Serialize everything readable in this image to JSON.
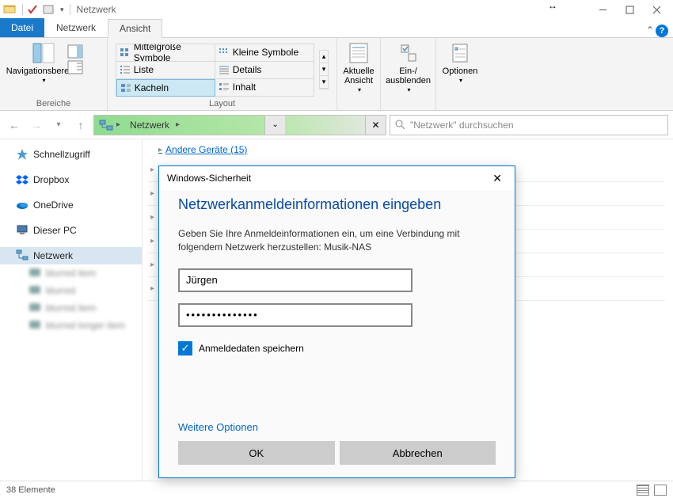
{
  "titlebar": {
    "title": "Netzwerk"
  },
  "tabs": {
    "file": "Datei",
    "network": "Netzwerk",
    "view": "Ansicht"
  },
  "ribbon": {
    "panes_btn": "Navigationsbereich",
    "panes_group": "Bereiche",
    "layout_group": "Layout",
    "layouts": {
      "medium": "Mittelgroße Symbole",
      "small": "Kleine Symbole",
      "list": "Liste",
      "details": "Details",
      "tiles": "Kacheln",
      "content": "Inhalt"
    },
    "current_view": "Aktuelle Ansicht",
    "show_hide": "Ein-/ ausblenden",
    "options": "Optionen"
  },
  "address": {
    "segment": "Netzwerk"
  },
  "search": {
    "placeholder": "\"Netzwerk\" durchsuchen"
  },
  "sidebar": {
    "quick": "Schnellzugriff",
    "dropbox": "Dropbox",
    "onedrive": "OneDrive",
    "this_pc": "Dieser PC",
    "network": "Netzwerk"
  },
  "content": {
    "group_other": "Andere Geräte (15)"
  },
  "dialog": {
    "window_title": "Windows-Sicherheit",
    "heading": "Netzwerkanmeldeinformationen eingeben",
    "instruction": "Geben Sie Ihre Anmeldeinformationen ein, um eine Verbindung mit folgendem Netzwerk herzustellen: Musik-NAS",
    "username": "Jürgen",
    "password": "••••••••••••••",
    "remember": "Anmeldedaten speichern",
    "more": "Weitere Optionen",
    "ok": "OK",
    "cancel": "Abbrechen"
  },
  "status": {
    "count": "38 Elemente"
  }
}
